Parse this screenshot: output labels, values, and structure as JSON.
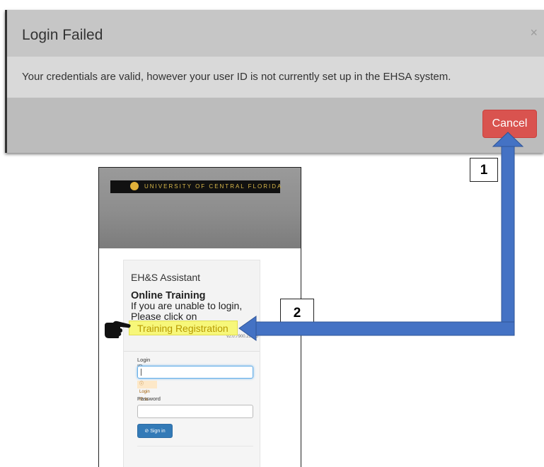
{
  "modal": {
    "title": "Login Failed",
    "close_symbol": "×",
    "message": "Your credentials are valid, however your user ID is not currently set up in the EHSA system.",
    "cancel_label": "Cancel"
  },
  "steps": {
    "one": "1",
    "two": "2"
  },
  "login_page": {
    "banner_text": "UNIVERSITY OF CENTRAL FLORIDA",
    "logo_icon": "pegasus-logo-icon",
    "app_name": "EH&S Assistant",
    "training_title": "Online Training",
    "training_text": "If you are unable to login, Please click on",
    "link_text": "Training Registration",
    "version": "v2.0.7900.29826",
    "login_id_label": "Login ID",
    "login_id_value": "",
    "login_id_error": "Login ID is required",
    "password_label": "Password",
    "password_value": "",
    "signin_label": "Sign in"
  },
  "annotations": {
    "arrow_color": "#4472c4",
    "pointer_icon": "pointing-hand-icon",
    "arrow_icon": "arrow-icon"
  },
  "colors": {
    "cancel_button": "#d9534f",
    "signin_button": "#337ab7",
    "link_highlight": "#f7f77a"
  }
}
